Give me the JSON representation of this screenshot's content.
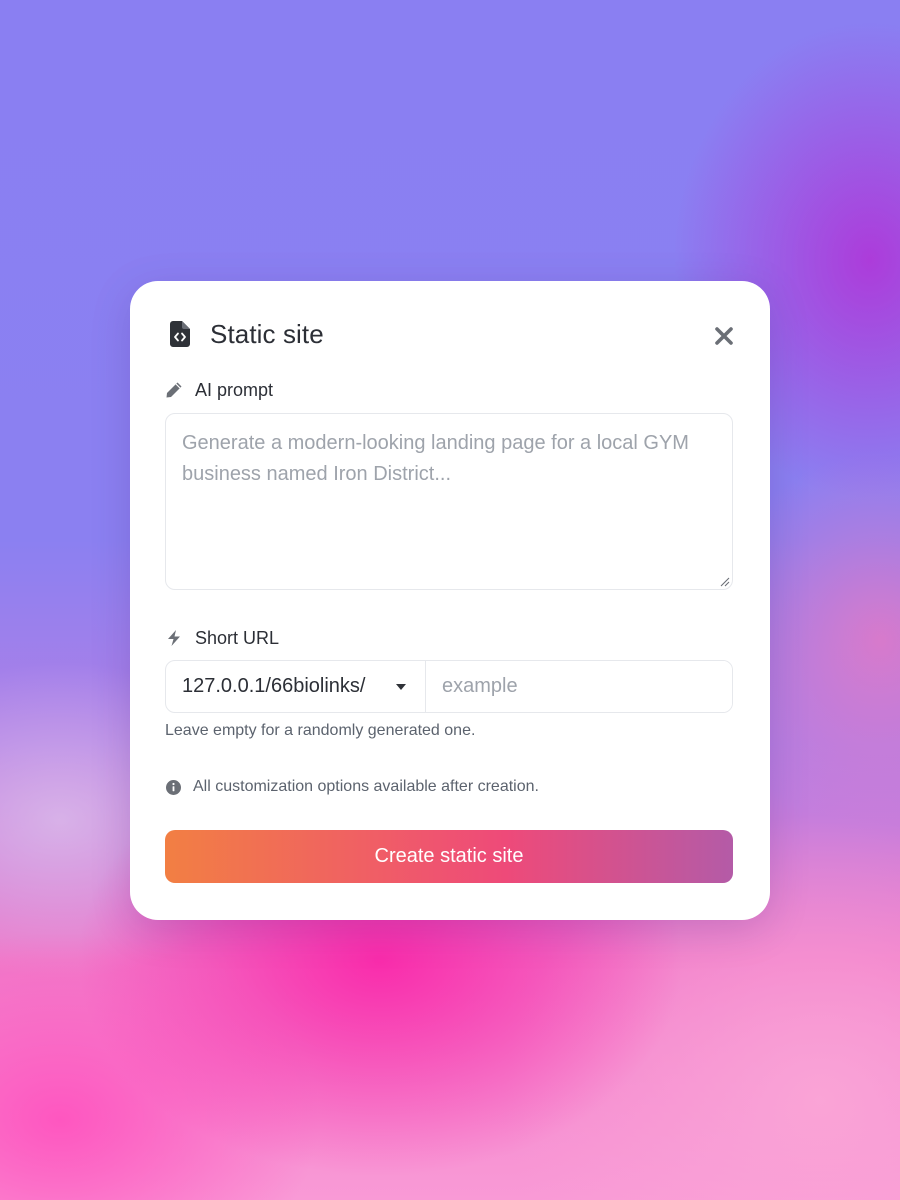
{
  "modal": {
    "title": "Static site",
    "title_icon": "file-code-icon",
    "close_icon": "close-icon"
  },
  "prompt": {
    "label": "AI prompt",
    "icon": "pencil-icon",
    "value": "",
    "placeholder": "Generate a modern-looking landing page for a local GYM business named Iron District..."
  },
  "short_url": {
    "label": "Short URL",
    "icon": "bolt-icon",
    "domain_selected": "127.0.0.1/66biolinks/",
    "value": "",
    "placeholder": "example",
    "helper": "Leave empty for a randomly generated one."
  },
  "info": {
    "icon": "info-circle-icon",
    "text": "All customization options available after creation."
  },
  "submit": {
    "label": "Create static site"
  },
  "colors": {
    "text_primary": "#2c2f36",
    "text_muted": "#5c636e",
    "placeholder": "#9ea3ab",
    "button_gradient_start": "#f27f43",
    "button_gradient_mid": "#ee4a79",
    "button_gradient_end": "#b45ba7"
  }
}
